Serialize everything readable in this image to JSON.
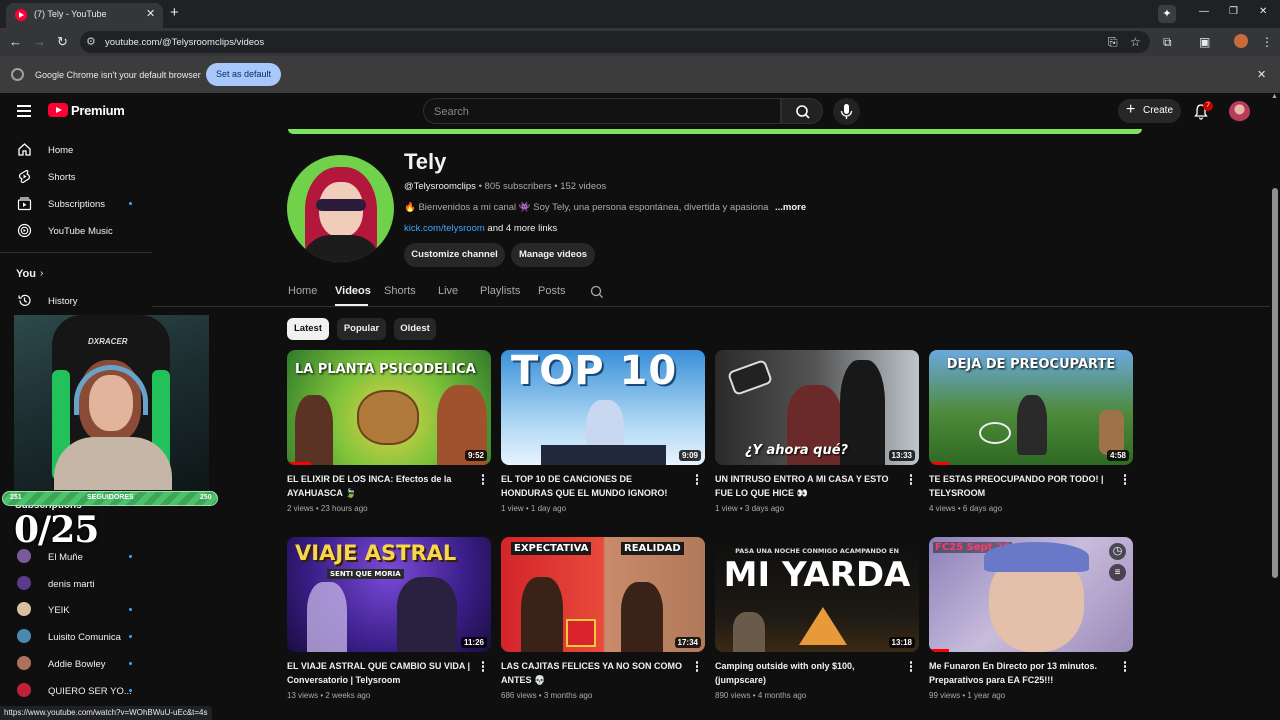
{
  "browser": {
    "tab_title": "(7) Tely - YouTube",
    "tab_close": "✕",
    "new_tab": "+",
    "url": "youtube.com/@Telysroomclips/videos",
    "default_banner": {
      "message": "Google Chrome isn't your default browser",
      "button": "Set as default",
      "close": "✕"
    },
    "status_url": "https://www.youtube.com/watch?v=WOhBWuU-uEc&t=4s"
  },
  "header": {
    "brand": "Premium",
    "search_placeholder": "Search",
    "create_label": "Create",
    "notification_count": "7"
  },
  "sidebar": {
    "items": [
      {
        "label": "Home",
        "icon": "home-icon"
      },
      {
        "label": "Shorts",
        "icon": "shorts-icon"
      },
      {
        "label": "Subscriptions",
        "icon": "subscriptions-icon"
      },
      {
        "label": "YouTube Music",
        "icon": "youtube-music-icon"
      }
    ],
    "you_label": "You",
    "history_label": "History",
    "subscriptions_heading": "Subscriptions",
    "subscriptions": [
      {
        "name": "El Muñe",
        "color": "#7a5a9a"
      },
      {
        "name": "denis marti",
        "color": "#5a3a8a"
      },
      {
        "name": "YEIK",
        "color": "#d8c0a0"
      },
      {
        "name": "Luisito Comunica",
        "color": "#4a8ab0"
      },
      {
        "name": "Addie Bowley",
        "color": "#b07060"
      },
      {
        "name": "QUIERO SER YO...",
        "color": "#c0203a"
      }
    ]
  },
  "overlay": {
    "follower_left": "251",
    "follower_label": "SEGUIDORES",
    "follower_right": "250",
    "counter": "0/25",
    "chair_brand": "DXRACER"
  },
  "channel": {
    "name": "Tely",
    "handle": "@Telysroomclips",
    "stats": " • 805 subscribers • 152 videos",
    "description": "🔥 Bienvenidos a mi canal 👾 Soy Tely, una persona espontánea, divertida y apasionada",
    "more": "...more",
    "link": "kick.com/telysroom",
    "more_links": " and 4 more links",
    "customize": "Customize channel",
    "manage": "Manage videos"
  },
  "tabs": [
    "Home",
    "Videos",
    "Shorts",
    "Live",
    "Playlists",
    "Posts"
  ],
  "active_tab": "Videos",
  "chips": [
    "Latest",
    "Popular",
    "Oldest"
  ],
  "videos": [
    {
      "title": "EL ELIXIR DE LOS INCA: Efectos de la AYAHUASCA 🍃",
      "meta": "2 views • 23 hours ago",
      "duration": "9:52",
      "thumb_text": "LA PLANTA PSICODELICA",
      "progress": 0.12
    },
    {
      "title": "EL TOP 10 DE CANCIONES DE HONDURAS QUE EL MUNDO IGNORO!",
      "meta": "1 view • 1 day ago",
      "duration": "9:09",
      "thumb_text": "TOP 10",
      "progress": 0
    },
    {
      "title": "UN INTRUSO ENTRO A MI CASA Y ESTO FUE LO QUE HICE 👀",
      "meta": "1 view • 3 days ago",
      "duration": "13:33",
      "thumb_text": "¿Y ahora qué?",
      "progress": 0
    },
    {
      "title": "TE ESTAS PREOCUPANDO POR TODO! | TELYSROOM",
      "meta": "4 views • 6 days ago",
      "duration": "4:58",
      "thumb_text": "DEJA DE PREOCUPARTE",
      "progress": 0.1
    },
    {
      "title": "EL VIAJE ASTRAL QUE CAMBIO SU VIDA | Conversatorio | Telysroom",
      "meta": "13 views • 2 weeks ago",
      "duration": "11:26",
      "thumb_text": "VIAJE ASTRAL",
      "thumb_sub": "SENTI QUE MORIA",
      "progress": 0
    },
    {
      "title": "LAS CAJITAS FELICES YA NO SON COMO ANTES 💀",
      "meta": "686 views • 3 months ago",
      "duration": "17:34",
      "thumb_text": "EXPECTATIVA",
      "thumb_sub": "REALIDAD",
      "progress": 0
    },
    {
      "title": "Camping outside with only $100, (jumpscare)",
      "meta": "890 views • 4 months ago",
      "duration": "13:18",
      "thumb_text": "MI YARDA",
      "thumb_sub": "PASA UNA NOCHE CONMIGO ACAMPANDO EN",
      "progress": 0
    },
    {
      "title": "Me Funaron En Directo por 13 minutos. Preparativos para EA FC25!!!",
      "meta": "99 views • 1 year ago",
      "duration": "",
      "thumb_text": "FC25 Sept 20",
      "progress": 0.1
    }
  ]
}
